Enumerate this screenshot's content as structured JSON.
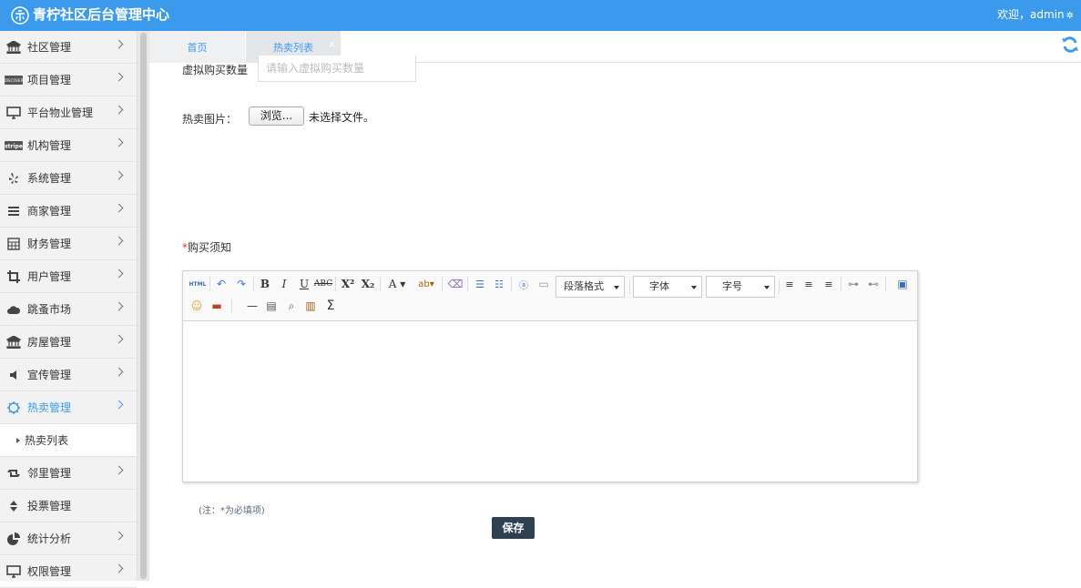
{
  "header": {
    "title": "青柠社区后台管理中心",
    "welcome": "欢迎，admin"
  },
  "sidebar": {
    "items": [
      {
        "label": "社区管理",
        "icon": "bank-icon"
      },
      {
        "label": "项目管理",
        "icon": "discover-card-icon"
      },
      {
        "label": "平台物业管理",
        "icon": "desktop-icon"
      },
      {
        "label": "机构管理",
        "icon": "stripe-icon"
      },
      {
        "label": "系统管理",
        "icon": "yelp-icon"
      },
      {
        "label": "商家管理",
        "icon": "bars-icon"
      },
      {
        "label": "财务管理",
        "icon": "calculator-icon"
      },
      {
        "label": "用户管理",
        "icon": "crop-icon"
      },
      {
        "label": "跳蚤市场",
        "icon": "cloud-icon"
      },
      {
        "label": "房屋管理",
        "icon": "bank-icon"
      },
      {
        "label": "宣传管理",
        "icon": "volume-icon"
      },
      {
        "label": "热卖管理",
        "icon": "gear-outline-icon",
        "active": true
      },
      {
        "label": "邻里管理",
        "icon": "retweet-icon"
      },
      {
        "label": "投票管理",
        "icon": "sort-icon"
      },
      {
        "label": "统计分析",
        "icon": "pie-chart-icon"
      },
      {
        "label": "权限管理",
        "icon": "desktop-icon"
      }
    ],
    "sub_item": "热卖列表"
  },
  "tabs": [
    {
      "label": "首页"
    },
    {
      "label": "热卖列表",
      "close": "×"
    }
  ],
  "form": {
    "virtual_qty_label": "虚拟购买数量",
    "virtual_qty_placeholder": "请输入虚拟购买数量",
    "image_label": "热卖图片：",
    "browse_label": "浏览...",
    "no_file": "未选择文件。",
    "notice_required": "*",
    "notice_label": "购买须知",
    "note": "(注：*为必填项)",
    "save_label": "保存"
  },
  "editor": {
    "paragraph_select": "段落格式",
    "font_select": "字体",
    "size_select": "字号",
    "html_button": "HTML"
  },
  "colors": {
    "header_bg": "#3c9aed",
    "accent": "#3c9aed",
    "save_bg": "#2f4050"
  }
}
